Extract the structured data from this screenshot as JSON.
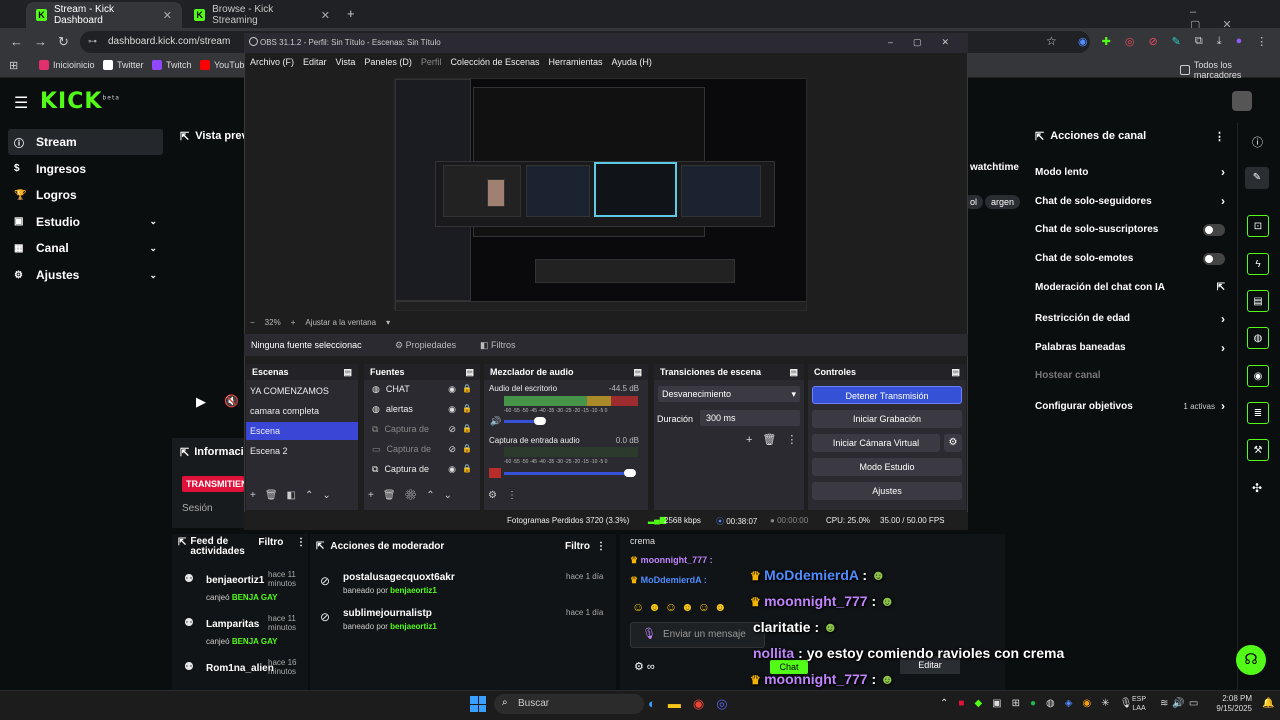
{
  "browser": {
    "tabs": [
      {
        "label": "Stream - Kick Dashboard"
      },
      {
        "label": "Browse - Kick Streaming"
      }
    ],
    "url": "dashboard.kick.com/stream",
    "bookmarks": [
      "Inicioinicio",
      "Twitter",
      "Twitch",
      "YouTube"
    ],
    "all_bookmarks": "Todos los marcadores"
  },
  "kick": {
    "logo": "KICK",
    "logo_sup": "beta",
    "sidebar": [
      {
        "label": "Stream",
        "icon": "info-icon"
      },
      {
        "label": "Ingresos",
        "icon": "money-icon"
      },
      {
        "label": "Logros",
        "icon": "trophy-icon"
      },
      {
        "label": "Estudio",
        "icon": "studio-icon",
        "chev": "⌄"
      },
      {
        "label": "Canal",
        "icon": "channel-icon",
        "chev": "⌄"
      },
      {
        "label": "Ajustes",
        "icon": "gear-icon",
        "chev": "⌄"
      }
    ],
    "preview_label": "Vista previ",
    "info_label": "Informació",
    "transmit_label": "TRANSMITIEN",
    "session_label": "Sesión",
    "watchtime": "watchtime",
    "chips": [
      "ol",
      "argen"
    ],
    "right_title": "Acciones de canal",
    "right_items": [
      {
        "label": "Modo lento",
        "kind": "arrow"
      },
      {
        "label": "Chat de solo-seguidores",
        "kind": "arrow"
      },
      {
        "label": "Chat de solo-suscriptores",
        "kind": "toggle"
      },
      {
        "label": "Chat de solo-emotes",
        "kind": "toggle"
      },
      {
        "label": "Moderación del chat con IA",
        "kind": "ext"
      },
      {
        "label": "Restricción de edad",
        "kind": "arrow"
      },
      {
        "label": "Palabras baneadas",
        "kind": "arrow"
      },
      {
        "label": "Hostear canal",
        "kind": "none"
      },
      {
        "label": "Configurar objetivos",
        "kind": "arrow",
        "badge": "1 activas"
      }
    ],
    "feed": {
      "title": "Feed de actividades",
      "filter": "Filtro",
      "items": [
        {
          "user": "benjaeortiz1",
          "ago": "hace 11 minutos",
          "action": "canjeó",
          "reward": "BENJA GAY"
        },
        {
          "user": "Lamparitas",
          "ago": "hace 11 minutos",
          "action": "canjeó",
          "reward": "BENJA GAY"
        },
        {
          "user": "Rom1na_alien",
          "ago": "hace 16 minutos",
          "action": "",
          "reward": ""
        }
      ]
    },
    "mod": {
      "title": "Acciones de moderador",
      "filter": "Filtro",
      "items": [
        {
          "user": "postalusagecquoxt6akr",
          "ago": "hace 1 día",
          "action": "baneado por",
          "by": "benjaeortiz1"
        },
        {
          "user": "sublimejournalistp",
          "ago": "hace 1 día",
          "action": "baneado por",
          "by": "benjaeortiz1"
        }
      ]
    },
    "chat": {
      "prev": "crema",
      "small": [
        {
          "user": "moonnight_777"
        },
        {
          "user": "MoDdemierdA"
        }
      ],
      "placeholder": "Enviar un mensaje",
      "chat_btn": "Chat",
      "edit": "Editar",
      "overlay": [
        {
          "user": "MoDdemierdA",
          "msg": ""
        },
        {
          "user": "moonnight_777",
          "msg": ""
        },
        {
          "user": "claritatie",
          "msg": ""
        },
        {
          "user": "nollita",
          "msg": "yo estoy comiendo ravioles con crema"
        },
        {
          "user": "moonnight_777",
          "msg": ""
        },
        {
          "user": "MoDdemierdA",
          "msg": ""
        }
      ]
    }
  },
  "obs": {
    "title": "OBS 31.1.2 - Perfil: Sin Título - Escenas: Sin Título",
    "menu": [
      "Archivo (F)",
      "Editar",
      "Vista",
      "Paneles (D)",
      "Perfil",
      "Colección de Escenas",
      "Herramientas",
      "Ayuda (H)"
    ],
    "zoom": "32%",
    "fit": "Ajustar a la ventana",
    "no_source": "Ninguna fuente seleccionac",
    "props": "Propiedades",
    "filters": "Filtros",
    "scenes_title": "Escenas",
    "scenes": [
      "YA COMENZAMOS",
      "camara completa",
      "Escena",
      "Escena 2"
    ],
    "selected_scene": 2,
    "sources_title": "Fuentes",
    "sources": [
      {
        "label": "CHAT",
        "dim": false
      },
      {
        "label": "alertas",
        "dim": false
      },
      {
        "label": "Captura de",
        "dim": true
      },
      {
        "label": "Captura de",
        "dim": true
      },
      {
        "label": "Captura de",
        "dim": false
      }
    ],
    "mixer_title": "Mezclador de audio",
    "mixer": [
      {
        "name": "Audio del escritorio",
        "db": "-44.5 dB"
      },
      {
        "name": "Captura de entrada audio",
        "db": "0.0 dB"
      }
    ],
    "mixer_scale": "-60 -55 -50 -45 -40 -35 -30 -25 -20 -15 -10 -5 0",
    "transitions_title": "Transiciones de escena",
    "transition": "Desvanecimiento",
    "duration_label": "Duración",
    "duration": "300 ms",
    "controls_title": "Controles",
    "controls": [
      "Detener Transmisión",
      "Iniciar Grabación",
      "Iniciar Cámara Virtual",
      "Modo Estudio",
      "Ajustes"
    ],
    "status": {
      "dropped": "Fotogramas Perdidos 3720 (3.3%)",
      "kbps": "2568 kbps",
      "live": "00:38:07",
      "rec": "00:00:00",
      "cpu": "CPU: 25.0%",
      "fps": "35.00 / 50.00 FPS"
    }
  },
  "taskbar": {
    "search": "Buscar",
    "lang": "ESP",
    "lang2": "LAA",
    "time": "2:08 PM",
    "date": "9/15/2025"
  },
  "colors": {
    "kick_green": "#53fc18",
    "obs_blue": "#3a47d6",
    "chat_purple": "#c084fc",
    "chat_blue": "#4f8cff"
  }
}
